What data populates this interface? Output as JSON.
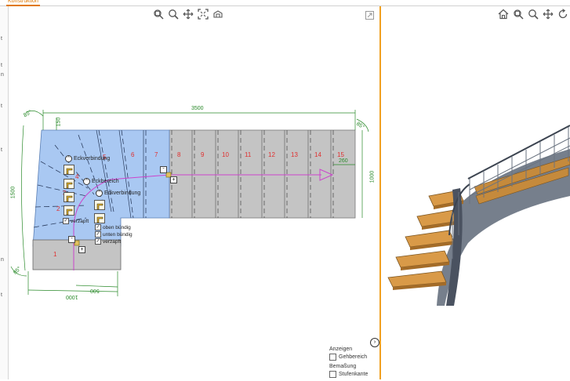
{
  "tab": {
    "label": "Konstruktion"
  },
  "side_markers": [
    "t",
    "t",
    "n",
    "t",
    "t",
    "n",
    "t"
  ],
  "plan": {
    "total_length": "3500",
    "right_width": "1000",
    "left_height": "1500",
    "bottom_short": "500",
    "bottom_long": "1000",
    "top_left_small": "150",
    "right_small": "260",
    "top_angle": "85°",
    "right_angle": "85°",
    "bottom_angle": "85°",
    "step_numbers": [
      "1",
      "2",
      "3",
      "4",
      "5",
      "6",
      "7",
      "8",
      "9",
      "10",
      "11",
      "12",
      "13",
      "14",
      "15"
    ],
    "labels": {
      "eckverbindung_1": "Eckverbindung",
      "eckbereich": "Eckbereich",
      "eckverbindung_2": "Eckverbindung",
      "verzapft_left": "verzapft"
    },
    "flush_options": [
      {
        "label": "oben bündig",
        "checked": true
      },
      {
        "label": "unten bündig",
        "checked": true
      },
      {
        "label": "verzapft",
        "checked": true
      }
    ],
    "colors": {
      "tread_blue": "#a9c8f2",
      "tread_grey": "#c4c4c4",
      "dimension_green": "#2a8a2a",
      "step_red": "#e03030",
      "walkline": "#cc44cc"
    }
  },
  "options_panel": {
    "anzeigen_label": "Anzeigen",
    "gehbereich_label": "Gehbereich",
    "bemassung_label": "Bemaßung",
    "stufenkante_label": "Stufenkante"
  },
  "left_toolbar_icons": [
    "zoom-window-icon",
    "zoom-icon",
    "pan-icon",
    "fit-icon",
    "view-3d-icon"
  ],
  "right_toolbar_icons": [
    "home-icon",
    "zoom-window-icon",
    "zoom-icon",
    "pan-icon",
    "rotate-icon"
  ]
}
